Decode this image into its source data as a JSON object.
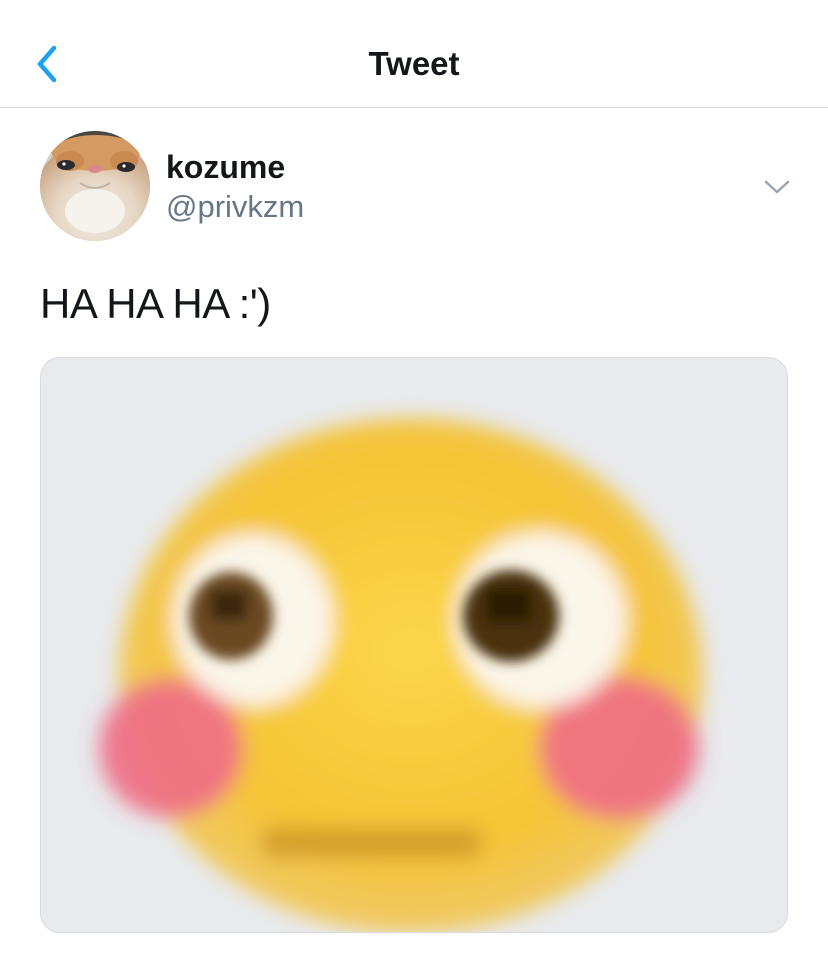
{
  "header": {
    "title": "Tweet",
    "back_icon": "chevron-left-icon"
  },
  "tweet": {
    "author": {
      "display_name": "kozume",
      "handle": "@privkzm"
    },
    "text": "HA HA HA :')",
    "more_icon": "chevron-down-icon",
    "media": {
      "description": "pixelated flushed face emoji"
    }
  },
  "colors": {
    "accent": "#1da1f2",
    "text_primary": "#14171a",
    "text_secondary": "#657786",
    "divider": "#d3d8dc",
    "emoji_yellow": "#f7c531",
    "emoji_blush": "#ef6f86"
  }
}
